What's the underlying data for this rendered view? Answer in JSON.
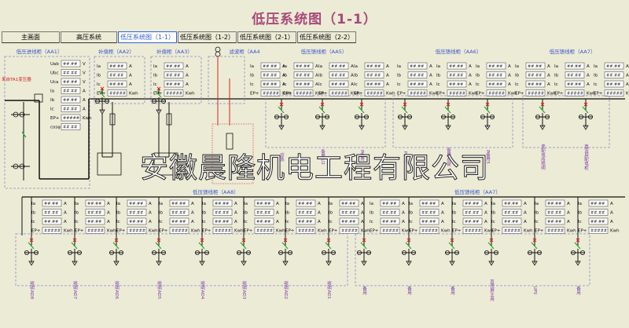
{
  "title": "低压系统图（1-1）",
  "tabs": [
    {
      "label": "主画面",
      "active": false
    },
    {
      "label": "高压系统",
      "active": false
    },
    {
      "label": "低压系统图（1-1）",
      "active": true
    },
    {
      "label": "低压系统图（1-2）",
      "active": false
    },
    {
      "label": "低压系统图（2-1）",
      "active": false
    },
    {
      "label": "低压系统图（2-2）",
      "active": false
    }
  ],
  "cabinets_top": [
    "低压进线柜（AA1）",
    "补偿柜（AA2）",
    "补偿柜（AA3）",
    "滤波柜（AA4",
    "低压馈线柜（AA5）",
    "低压馈线柜（AA6）",
    "低压馈线柜（AA7）"
  ],
  "cabinets_bottom": [
    "低压馈线柜（AA8）",
    "低压馈线柜（AA7）"
  ],
  "source_label": "来自TA1变压器",
  "placeholder_value": "##.##",
  "long_value": "#####",
  "unit_A": "A",
  "unit_V": "V",
  "unit_kwh": "Kwh",
  "meter_rows_incomer": [
    {
      "label": "Uab",
      "unit": "V"
    },
    {
      "label": "Ubc",
      "unit": "V"
    },
    {
      "label": "Uca",
      "unit": "V"
    },
    {
      "label": "Ia",
      "unit": "A"
    },
    {
      "label": "Ib",
      "unit": "A"
    },
    {
      "label": "Ic",
      "unit": "A"
    },
    {
      "label": "EP+",
      "unit": "Kwh"
    },
    {
      "label": "cosφ",
      "unit": ""
    }
  ],
  "meter_rows_feeder": [
    "Ia",
    "Ib",
    "Ic",
    "EP+"
  ],
  "feeders_top": [
    "应急",
    "备用1/2",
    "P备用3",
    "P备用",
    "备用/负荷",
    "P备用5",
    "变配电所照明",
    "直流屏配电柜"
  ],
  "feeders_bottom": [
    "照明AD8",
    "照明AD7",
    "照明AD6",
    "照明AD5",
    "照明AD4",
    "照明AD3",
    "照明AD2",
    "照明AD1",
    "备用",
    "备用",
    "备用",
    "直流屏主用",
    "UPS",
    "备用"
  ],
  "watermark": "安徽晨隆机电工程有限公司",
  "colors": {
    "background": "#ecebd6",
    "title": "#a84a7a",
    "cabinet_label": "#3b56c8",
    "dashed_box": "#8a8ac8",
    "breaker_closed": "#22aa22",
    "breaker_open": "#dd2222",
    "filter_box": "#e07070"
  }
}
